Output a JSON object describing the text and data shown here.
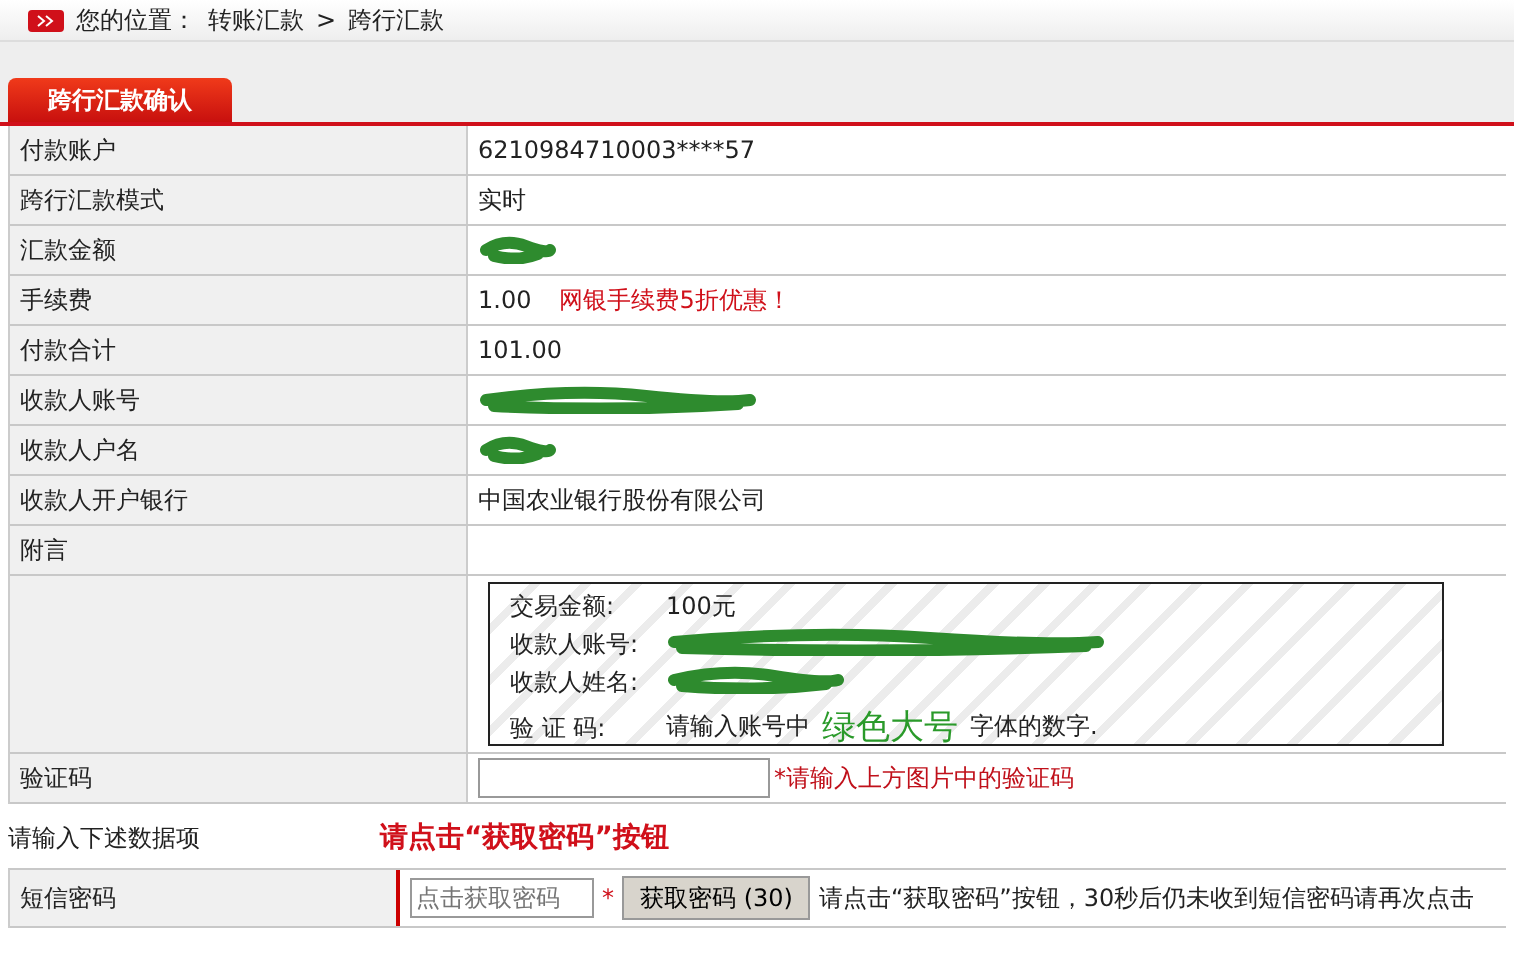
{
  "breadcrumb": {
    "label": "您的位置：",
    "path": [
      "转账汇款",
      "跨行汇款"
    ],
    "separator": ">"
  },
  "tab": {
    "label": "跨行汇款确认",
    "selected": true
  },
  "rows": [
    {
      "label": "付款账户",
      "value": "6210984710003****57",
      "redacted": false
    },
    {
      "label": "跨行汇款模式",
      "value": "实时",
      "redacted": false
    },
    {
      "label": "汇款金额",
      "redacted": true
    },
    {
      "label": "手续费",
      "value": "1.00",
      "note": "网银手续费5折优惠！",
      "redacted": false
    },
    {
      "label": "付款合计",
      "value": "101.00",
      "redacted": false
    },
    {
      "label": "收款人账号",
      "redacted": true
    },
    {
      "label": "收款人户名",
      "redacted": true
    },
    {
      "label": "收款人开户银行",
      "value": "中国农业银行股份有限公司",
      "redacted": false
    },
    {
      "label": "附言",
      "value": "",
      "redacted": false
    }
  ],
  "captcha": {
    "lines": [
      {
        "label": "交易金额:",
        "value": "100元",
        "redacted": false
      },
      {
        "label": "收款人账号:",
        "redacted": true
      },
      {
        "label": "收款人姓名:",
        "redacted": true
      }
    ],
    "code_label": "验 证 码:",
    "hint_before": "请输入账号中",
    "hint_emphasis": "绿色大号",
    "hint_after": "字体的数字."
  },
  "verify": {
    "label": "验证码",
    "hint": "*请输入上方图片中的验证码"
  },
  "section": {
    "label": "请输入下述数据项",
    "notice": "请点击“获取密码”按钮"
  },
  "sms": {
    "label": "短信密码",
    "placeholder": "点击获取密码",
    "required": "*",
    "button": "获取密码 (30)",
    "hint": "请点击“获取密码”按钮，30秒后仍未收到短信密码请再次点击"
  }
}
